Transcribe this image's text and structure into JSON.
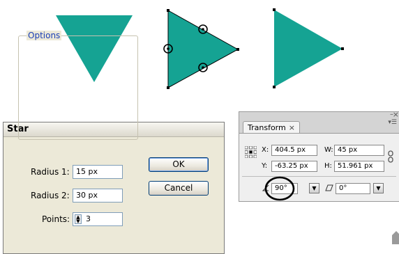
{
  "colors": {
    "shape_fill": "#15a393",
    "dialog_bg": "#ece9d8",
    "panel_bg": "#efefef",
    "legend_text": "#1a3fb5"
  },
  "star_dialog": {
    "title": "Star",
    "group_label": "Options",
    "radius1": {
      "label": "Radius 1:",
      "value": "15 px"
    },
    "radius2": {
      "label": "Radius 2:",
      "value": "30 px"
    },
    "points": {
      "label": "Points:",
      "value": "3"
    },
    "ok_label": "OK",
    "cancel_label": "Cancel"
  },
  "transform_panel": {
    "tab_label": "Transform",
    "tab_close": "×",
    "minimize": "–",
    "close": "×",
    "menu_icon": "panel-menu-icon",
    "x": {
      "label": "X:",
      "value": "404.5 px"
    },
    "y": {
      "label": "Y:",
      "value": "-63.25 px"
    },
    "w": {
      "label": "W:",
      "value": "45 px"
    },
    "h": {
      "label": "H:",
      "value": "51.961 px"
    },
    "rotate": {
      "value": "90°"
    },
    "shear": {
      "value": "0°"
    }
  }
}
